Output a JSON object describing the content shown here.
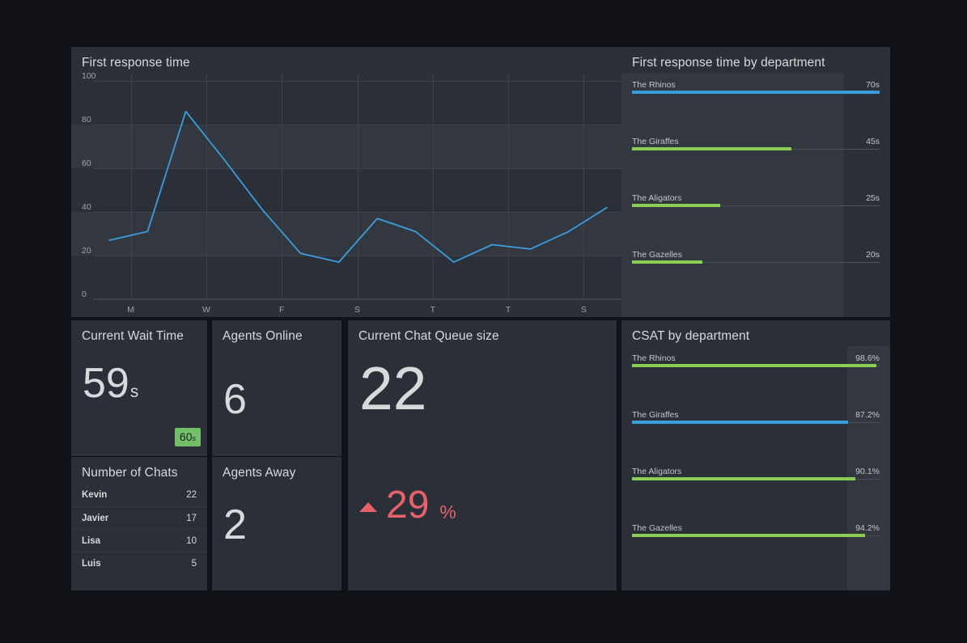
{
  "theme": {
    "page_bg": "#111217",
    "panel_bg": "#2b2f37",
    "band_bg": "#33373f",
    "text": "#d8d9da",
    "muted_text": "#9fa4ab",
    "grid": "#3d424b",
    "blue": "#3b9ddd",
    "green": "#8ace56",
    "red": "#e5626a",
    "badge_green": "#73bf69"
  },
  "panels": {
    "first_response_time": {
      "title": "First response time"
    },
    "frt_by_department": {
      "title": "First response time by department"
    },
    "current_wait_time": {
      "title": "Current Wait Time",
      "value": "59",
      "unit": "s",
      "threshold_value": "60",
      "threshold_unit": "s"
    },
    "agents_online": {
      "title": "Agents Online",
      "value": "6"
    },
    "number_of_chats": {
      "title": "Number of Chats"
    },
    "agents_away": {
      "title": "Agents Away",
      "value": "2"
    },
    "chat_queue_size": {
      "title": "Current Chat Queue size",
      "value": "22",
      "delta_value": "29",
      "delta_unit": "%",
      "delta_direction": "up"
    },
    "csat_by_department": {
      "title": "CSAT by department"
    }
  },
  "number_of_chats_table": {
    "rows": [
      {
        "name": "Kevin",
        "count": "22"
      },
      {
        "name": "Javier",
        "count": "17"
      },
      {
        "name": "Lisa",
        "count": "10"
      },
      {
        "name": "Luis",
        "count": "5"
      }
    ]
  },
  "chart_data": [
    {
      "id": "first_response_time",
      "type": "line",
      "title": "First response time",
      "xlabel": "",
      "ylabel": "",
      "ylim": [
        0,
        100
      ],
      "yticks": [
        0,
        20,
        40,
        60,
        80,
        100
      ],
      "xticks": [
        "M",
        "W",
        "F",
        "S",
        "T",
        "T",
        "S"
      ],
      "grid": true,
      "legend": "none",
      "series": [
        {
          "name": "First response time",
          "color": "#3b9ddd",
          "x": [
            0,
            1,
            2,
            3,
            4,
            5,
            6,
            7,
            8,
            9,
            10,
            11,
            12,
            13,
            14,
            15,
            16
          ],
          "values": [
            27,
            31,
            86,
            64,
            41,
            21,
            17,
            37,
            31,
            17,
            25,
            23,
            31,
            42
          ]
        }
      ]
    },
    {
      "id": "frt_by_department",
      "type": "bar",
      "orientation": "horizontal",
      "title": "First response time by department",
      "unit": "s",
      "max": 70,
      "categories": [
        "The Rhinos",
        "The Giraffes",
        "The Aligators",
        "The Gazelles"
      ],
      "values": [
        70,
        45,
        25,
        20
      ],
      "value_labels": [
        "70s",
        "45s",
        "25s",
        "20s"
      ],
      "colors": [
        "#3b9ddd",
        "#8ace56",
        "#8ace56",
        "#8ace56"
      ]
    },
    {
      "id": "csat_by_department",
      "type": "bar",
      "orientation": "horizontal",
      "title": "CSAT by department",
      "unit": "%",
      "max": 100,
      "categories": [
        "The Rhinos",
        "The Giraffes",
        "The Aligators",
        "The Gazelles"
      ],
      "values": [
        98.6,
        87.2,
        90.1,
        94.2
      ],
      "value_labels": [
        "98.6%",
        "87.2%",
        "90.1%",
        "94.2%"
      ],
      "colors": [
        "#8ace56",
        "#3b9ddd",
        "#8ace56",
        "#8ace56"
      ]
    }
  ]
}
